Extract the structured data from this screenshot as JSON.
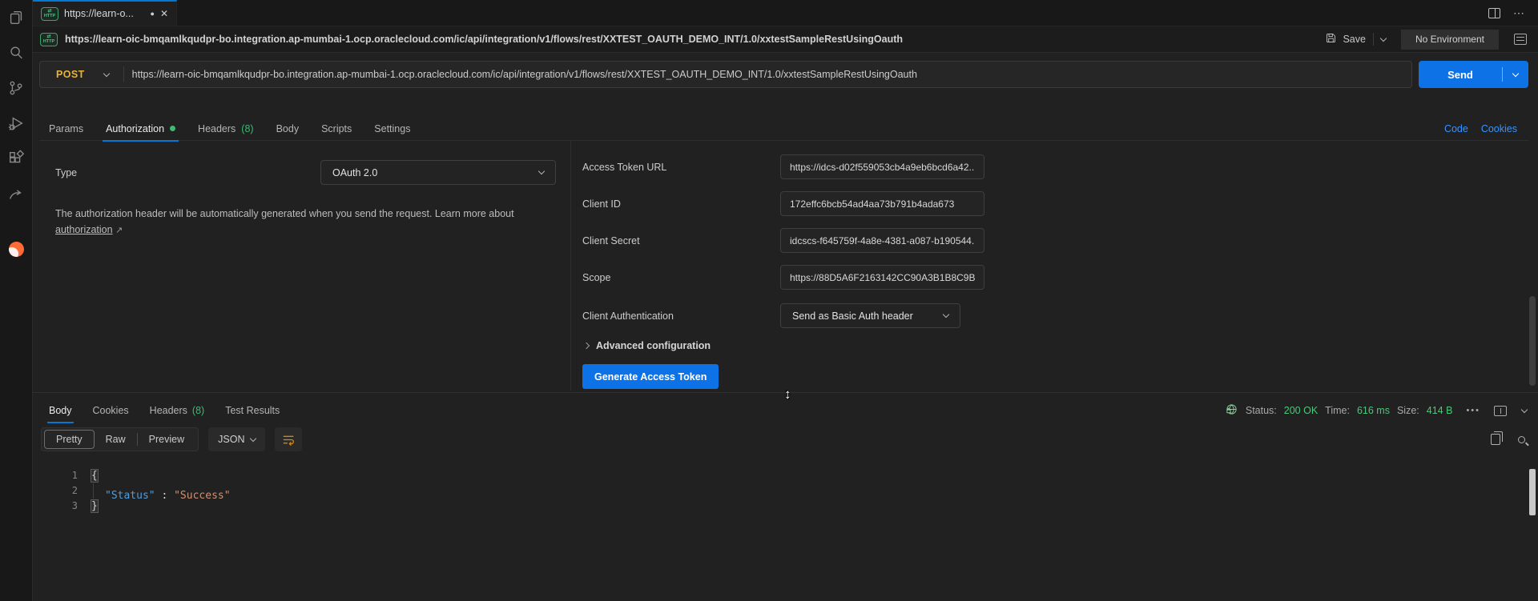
{
  "colors": {
    "accent_blue": "#0d72e5",
    "tab_accent_blue": "#0078d4",
    "method_post_yellow": "#e8b339",
    "success_green": "#49c97a",
    "tab_badge_green": "#3dba73",
    "link_blue": "#3794ff",
    "logo_orange": "#ff6c37",
    "code_key_blue": "#569cd6",
    "code_string_orange": "#ce9178"
  },
  "icons": [
    "files-icon",
    "search-icon",
    "source-control-icon",
    "run-debug-icon",
    "extensions-icon",
    "share-icon",
    "postman-icon",
    "http-method-icon",
    "save-icon",
    "chevron-down-icon",
    "environment-icon",
    "split-editor-icon",
    "more-icon",
    "globe-lock-icon",
    "ellipsis-icon",
    "split-pane-icon",
    "wrap-text-icon",
    "copy-icon",
    "search-small-icon",
    "resize-cursor"
  ],
  "window": {
    "http_badge": "HTTP",
    "tab_title": "https://learn-o...",
    "unsaved_dot": "●",
    "close": "✕",
    "more": "⋯"
  },
  "toolbar": {
    "breadcrumb_url": "https://learn-oic-bmqamlkqudpr-bo.integration.ap-mumbai-1.ocp.oraclecloud.com/ic/api/integration/v1/flows/rest/XXTEST_OAUTH_DEMO_INT/1.0/xxtestSampleRestUsingOauth",
    "save_label": "Save",
    "environment": "No Environment"
  },
  "request": {
    "method": "POST",
    "url": "https://learn-oic-bmqamlkqudpr-bo.integration.ap-mumbai-1.ocp.oraclecloud.com/ic/api/integration/v1/flows/rest/XXTEST_OAUTH_DEMO_INT/1.0/xxtestSampleRestUsingOauth",
    "send_label": "Send",
    "tabs": [
      {
        "label": "Params"
      },
      {
        "label": "Authorization"
      },
      {
        "label": "Headers",
        "count": "(8)"
      },
      {
        "label": "Body"
      },
      {
        "label": "Scripts"
      },
      {
        "label": "Settings"
      }
    ],
    "code_link": "Code",
    "cookies_link": "Cookies"
  },
  "auth": {
    "type_label": "Type",
    "type_value": "OAuth 2.0",
    "helper_text": "The authorization header will be automatically generated when you send the request. Learn more about",
    "helper_link_label": "authorization",
    "external_arrow": "↗",
    "fields": [
      {
        "label": "Access Token URL",
        "value": "https://idcs-d02f559053cb4a9eb6bcd6a42..."
      },
      {
        "label": "Client ID",
        "value": "172effc6bcb54ad4aa73b791b4ada673"
      },
      {
        "label": "Client Secret",
        "value": "idcscs-f645759f-4a8e-4381-a087-b190544..."
      },
      {
        "label": "Scope",
        "value": "https://88D5A6F2163142CC90A3B1B8C9B..."
      },
      {
        "label": "Client Authentication",
        "value": "Send as Basic Auth header"
      }
    ],
    "advanced_label": "Advanced configuration",
    "generate_button_label": "Generate Access Token"
  },
  "response": {
    "tabs": [
      {
        "label": "Body"
      },
      {
        "label": "Cookies"
      },
      {
        "label": "Headers",
        "count": "(8)"
      },
      {
        "label": "Test Results"
      }
    ],
    "status_label": "Status:",
    "status_value": "200 OK",
    "time_label": "Time:",
    "time_value": "616 ms",
    "size_label": "Size:",
    "size_value": "414 B",
    "more_dots": "•••",
    "view_modes": [
      {
        "label": "Pretty"
      },
      {
        "label": "Raw"
      },
      {
        "label": "Preview"
      }
    ],
    "format_selector": "JSON",
    "code": {
      "line_numbers": [
        "1",
        "2",
        "3"
      ],
      "line1": "{",
      "line2_key": "\"Status\"",
      "line2_sep": " : ",
      "line2_value": "\"Success\"",
      "line3": "}"
    }
  }
}
